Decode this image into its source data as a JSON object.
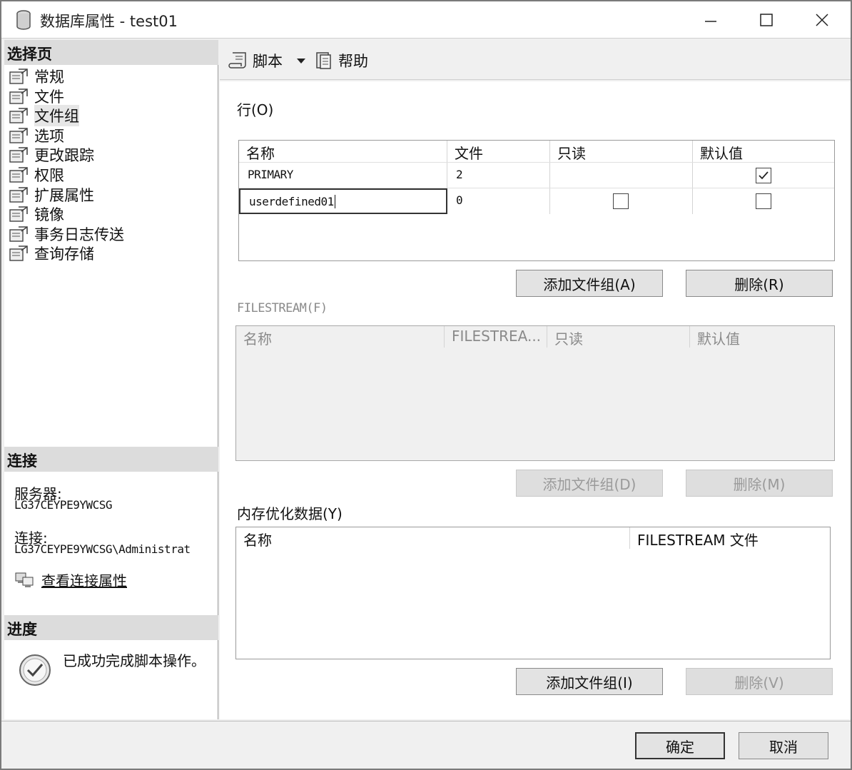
{
  "window": {
    "title": "数据库属性 - test01",
    "controls": {
      "minimize": "—",
      "maximize": "☐",
      "close": "✕"
    }
  },
  "left": {
    "select_page_header": "选择页",
    "pages": [
      {
        "label": "常规",
        "icon": "page-settings-icon"
      },
      {
        "label": "文件",
        "icon": "page-settings-icon"
      },
      {
        "label": "文件组",
        "icon": "page-settings-icon",
        "selected": true
      },
      {
        "label": "选项",
        "icon": "page-settings-icon"
      },
      {
        "label": "更改跟踪",
        "icon": "page-settings-icon"
      },
      {
        "label": "权限",
        "icon": "page-settings-icon"
      },
      {
        "label": "扩展属性",
        "icon": "page-settings-icon"
      },
      {
        "label": "镜像",
        "icon": "page-settings-icon"
      },
      {
        "label": "事务日志传送",
        "icon": "page-settings-icon"
      },
      {
        "label": "查询存储",
        "icon": "page-settings-icon"
      }
    ],
    "connection_header": "连接",
    "server_label": "服务器:",
    "server_value": "LG37CEYPE9YWCSG",
    "connection_label": "连接:",
    "connection_value": "LG37CEYPE9YWCSG\\Administrat",
    "view_connection_link": "查看连接属性",
    "progress_header": "进度",
    "progress_text": "已成功完成脚本操作。"
  },
  "toolbar": {
    "script_label": "脚本",
    "help_label": "帮助"
  },
  "rows_section": {
    "label": "行(O)",
    "columns": [
      "名称",
      "文件",
      "只读",
      "默认值"
    ],
    "rows": [
      {
        "name": "PRIMARY",
        "files": "2",
        "readonly": null,
        "default": true
      },
      {
        "name": "userdefined01",
        "files": "0",
        "readonly": false,
        "default": false
      }
    ],
    "add_button": "添加文件组(A)",
    "remove_button": "删除(R)"
  },
  "filestream_section": {
    "label": "FILESTREAM(F)",
    "columns": [
      "名称",
      "FILESTREA...",
      "只读",
      "默认值"
    ],
    "add_button": "添加文件组(D)",
    "remove_button": "删除(M)"
  },
  "memory_section": {
    "label": "内存优化数据(Y)",
    "columns": [
      "名称",
      "FILESTREAM 文件"
    ],
    "add_button": "添加文件组(I)",
    "remove_button": "删除(V)"
  },
  "footer": {
    "ok_button": "确定",
    "cancel_button": "取消"
  }
}
